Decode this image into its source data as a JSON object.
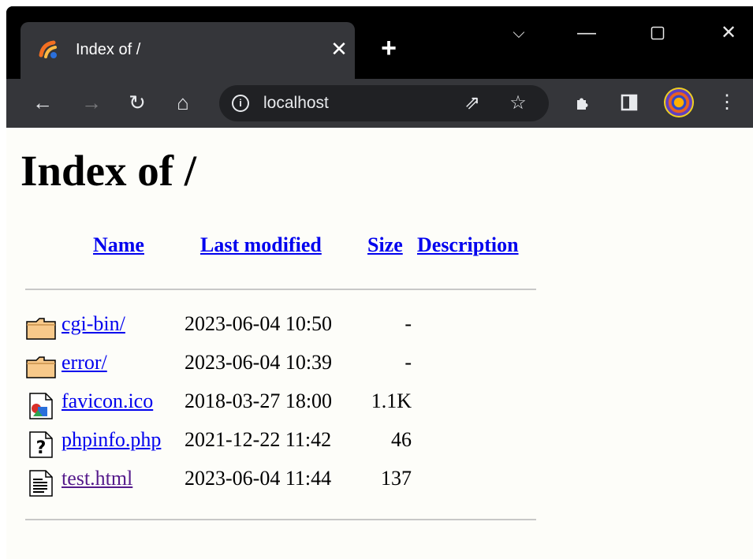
{
  "browser": {
    "tab_title": "Index of /",
    "new_tab_label": "+",
    "url": "localhost"
  },
  "page": {
    "heading": "Index of /",
    "columns": {
      "name": "Name",
      "last_modified": "Last modified",
      "size": "Size",
      "description": "Description"
    },
    "rows": [
      {
        "name": "cgi-bin/",
        "modified": "2023-06-04 10:50",
        "size": "-",
        "icon": "folder-icon"
      },
      {
        "name": "error/",
        "modified": "2023-06-04 10:39",
        "size": "-",
        "icon": "folder-icon"
      },
      {
        "name": "favicon.ico",
        "modified": "2018-03-27 18:00",
        "size": "1.1K",
        "icon": "image-file-icon"
      },
      {
        "name": "phpinfo.php",
        "modified": "2021-12-22 11:42",
        "size": "46",
        "icon": "unknown-file-icon"
      },
      {
        "name": "test.html",
        "modified": "2023-06-04 11:44",
        "size": "137",
        "icon": "text-file-icon"
      }
    ]
  },
  "colors": {
    "link": "#0000ee",
    "visited_link": "#551a8b",
    "page_background": "#fdfdf9",
    "toolbar": "#35363a"
  }
}
